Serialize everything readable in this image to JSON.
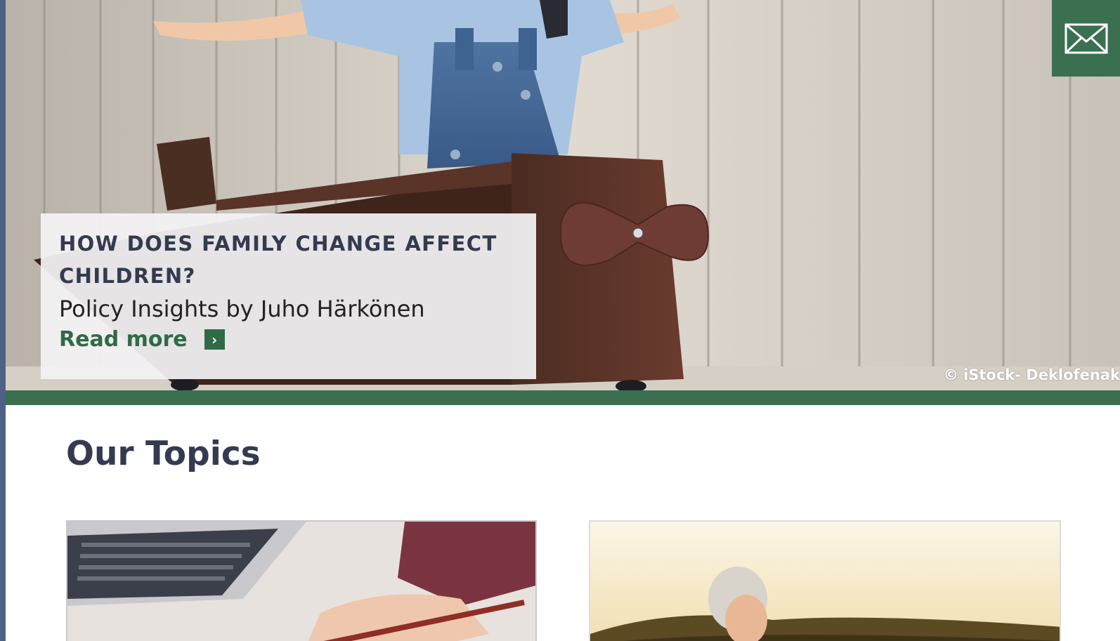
{
  "hero": {
    "headline": "HOW DOES FAMILY CHANGE AFFECT CHILDREN?",
    "subtitle": "Policy Insights by Juho Härkönen",
    "read_more_label": "Read more",
    "read_more_arrow": "›",
    "photo_credit": "© iStock- Deklofenak",
    "image_description": "child-in-wooden-toy-airplane"
  },
  "mail_button": {
    "icon": "envelope-icon"
  },
  "topics": {
    "heading": "Our Topics",
    "cards": [
      {
        "image": "laptop-and-pen-photo"
      },
      {
        "image": "elderly-woman-sunset-photo"
      }
    ]
  },
  "colors": {
    "brand_green": "#3a7050",
    "link_green": "#2f6b45",
    "heading_navy": "#343a50",
    "left_edge": "#4e6185"
  }
}
